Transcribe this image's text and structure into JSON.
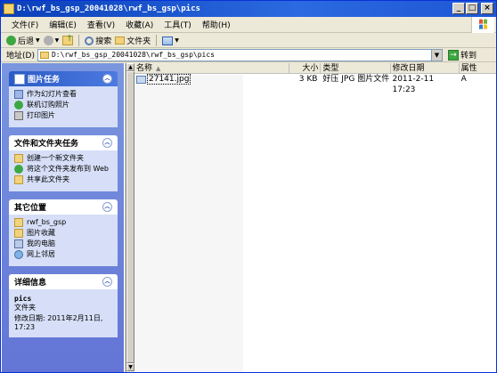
{
  "window": {
    "title": "D:\\rwf_bs_gsp_20041028\\rwf_bs_gsp\\pics",
    "minimize": "_",
    "maximize": "□",
    "close": "×"
  },
  "menubar": {
    "items": [
      "文件(F)",
      "编辑(E)",
      "查看(V)",
      "收藏(A)",
      "工具(T)",
      "帮助(H)"
    ]
  },
  "toolbar": {
    "back_label": "后退",
    "search_label": "搜索",
    "folders_label": "文件夹"
  },
  "address": {
    "label": "地址(D)",
    "value": "D:\\rwf_bs_gsp_20041028\\rwf_bs_gsp\\pics",
    "go_label": "转到"
  },
  "taskpane": {
    "picture_tasks": {
      "title": "图片任务",
      "items": [
        "作为幻灯片查看",
        "联机订购照片",
        "打印图片"
      ]
    },
    "file_tasks": {
      "title": "文件和文件夹任务",
      "items": [
        "创建一个新文件夹",
        "将这个文件夹发布到 Web",
        "共享此文件夹"
      ]
    },
    "other_places": {
      "title": "其它位置",
      "items": [
        "rwf_bs_gsp",
        "图片收藏",
        "我的电脑",
        "网上邻居"
      ]
    },
    "details": {
      "title": "详细信息",
      "name": "pics",
      "type": "文件夹",
      "modified": "修改日期: 2011年2月11日, 17:23"
    }
  },
  "filelist": {
    "columns": [
      "名称",
      "大小",
      "类型",
      "修改日期",
      "属性"
    ],
    "rows": [
      {
        "name": "27141.jpg",
        "size": "3 KB",
        "type": "好压 JPG 图片文件",
        "date": "2011-2-11 17:23",
        "attr": "A"
      }
    ]
  },
  "colors": {
    "title_bar": "#1e56d4",
    "task_pane_bg": "#6c82d0",
    "panel_body": "#d6dff7",
    "details_head": "#2254b8"
  }
}
